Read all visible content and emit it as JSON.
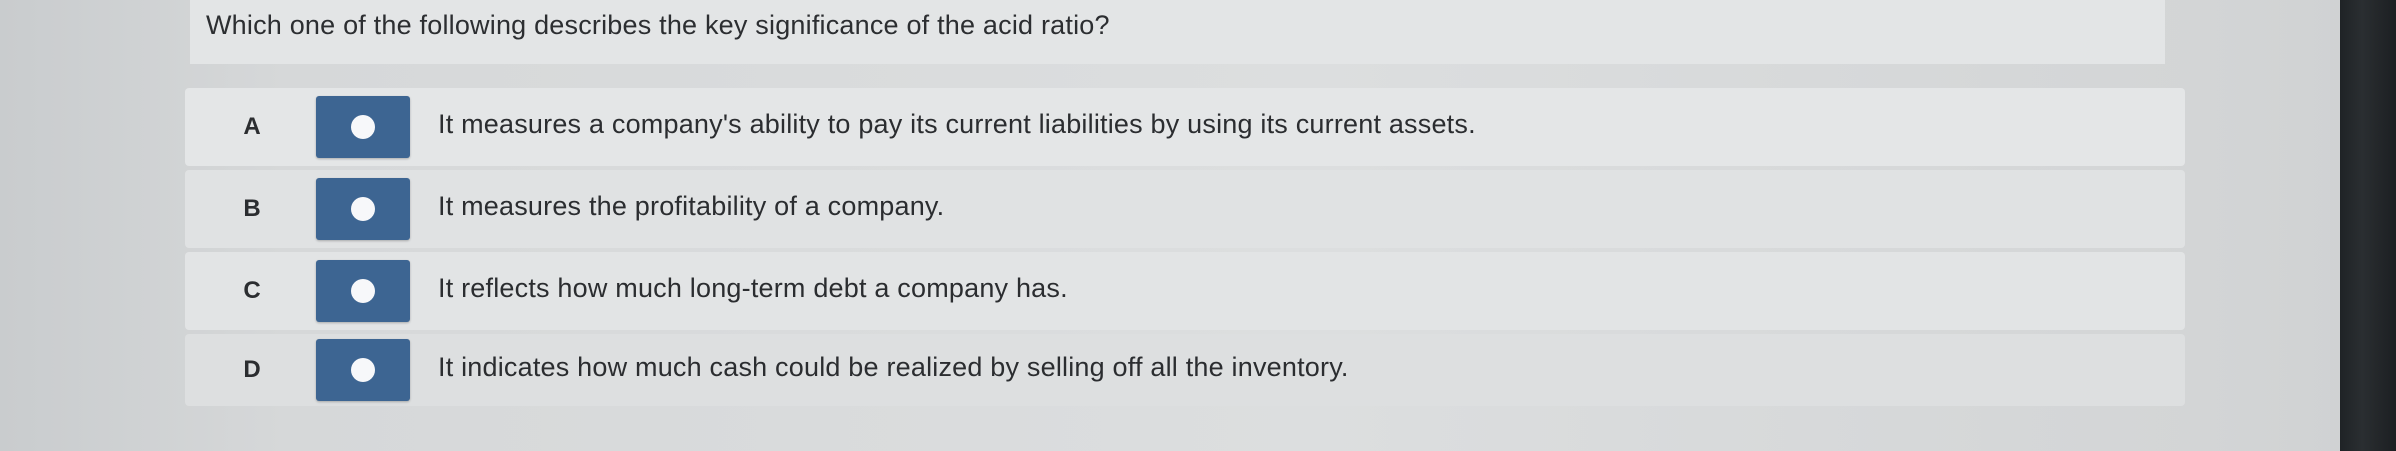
{
  "question": {
    "text": "Which one of the following describes the key significance of the acid ratio?"
  },
  "options": [
    {
      "letter": "A",
      "text": "It measures a company's ability to pay its current liabilities by using its current assets."
    },
    {
      "letter": "B",
      "text": "It measures the profitability of a company."
    },
    {
      "letter": "C",
      "text": "It reflects how much long-term debt a company has."
    },
    {
      "letter": "D",
      "text": "It indicates how much cash could be realized by selling off all the inventory."
    }
  ],
  "colors": {
    "radio_button": "#3d6592",
    "radio_dot": "#f7f8fa",
    "text": "#2b2d30"
  }
}
